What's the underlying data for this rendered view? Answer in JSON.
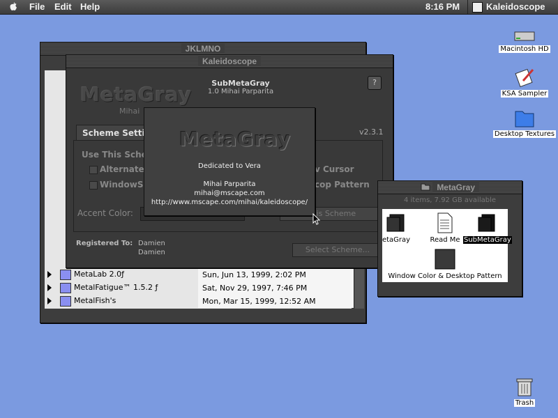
{
  "menubar": {
    "menus": [
      "File",
      "Edit",
      "Help"
    ],
    "clock": "8:16 PM",
    "active_app": "Kaleidoscope"
  },
  "desktop": {
    "icons": [
      "Macintosh HD",
      "KSA Sampler",
      "Desktop Textures",
      "Trash"
    ]
  },
  "finder_window": {
    "title": "JKLMNO",
    "rows": [
      {
        "name": "MetaLab 2.0ƒ",
        "date": "Sun, Jun 13, 1999, 2:02 PM"
      },
      {
        "name": "MetalFatigue™ 1.5.2 ƒ",
        "date": "Sat, Nov 29, 1997, 7:46 PM"
      },
      {
        "name": "MetalFish's",
        "date": "Mon, Mar 15, 1999, 12:52 AM"
      }
    ]
  },
  "kaleidoscope": {
    "title": "Kaleidoscope",
    "logo": "MetaGray",
    "logo_sub": "Mihai",
    "scheme_name": "SubMetaGray",
    "scheme_version": "1.0 Mihai Parparita",
    "app_version": "v2.3.1",
    "tab": "Scheme Settin",
    "use_scheme": "Use This Schem",
    "opt_alternate": "Alternate",
    "opt_windowsh": "WindowSh",
    "opt_cursor": "v Cursor",
    "opt_pattern": "cop Pattern",
    "accent_label": "Accent Color:",
    "this_scheme_btn": "This Scheme",
    "registered_label": "Registered To:",
    "registered_name": "Damien",
    "registered_org": "Damien",
    "select_scheme_btn": "Select Scheme..."
  },
  "about": {
    "logo": "MetaGray",
    "dedication": "Dedicated to Vera",
    "author": "Mihai Parparita",
    "email": "mihai@mscape.com",
    "url": "http://www.mscape.com/mihai/kaleidoscope/"
  },
  "metagray_window": {
    "title": "MetaGray",
    "status": "4 items, 7.92 GB available",
    "items": [
      "etaGray",
      "Read Me",
      "SubMetaGray",
      "Window Color & Desktop Pattern"
    ]
  }
}
